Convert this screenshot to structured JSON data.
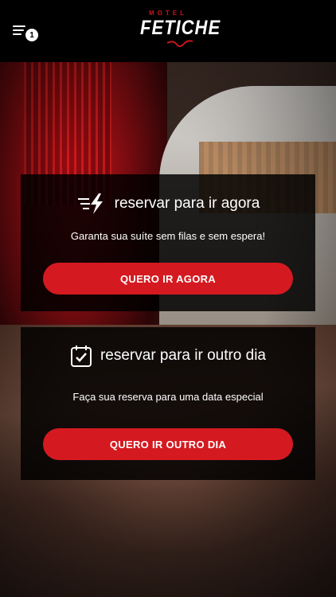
{
  "header": {
    "menu_badge": "1",
    "logo": {
      "small": "MOTEL",
      "main": "FETICHE"
    }
  },
  "cards": [
    {
      "icon": "fast-lightning-icon",
      "title": "reservar para ir agora",
      "subtitle": "Garanta sua suíte sem filas e sem espera!",
      "button": "QUERO IR AGORA"
    },
    {
      "icon": "calendar-check-icon",
      "title": "reservar para ir outro dia",
      "subtitle": "Faça sua reserva para uma data especial",
      "button": "QUERO IR OUTRO DIA"
    }
  ],
  "colors": {
    "accent": "#d41a20",
    "header_bg": "#000000",
    "card_bg": "rgba(0,0,0,0.84)"
  }
}
